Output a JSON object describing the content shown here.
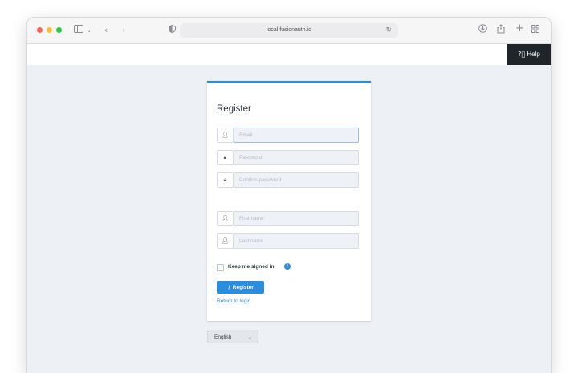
{
  "browser": {
    "url": "local.fusionauth.io",
    "icons": {
      "sidebar": "sidebar-icon",
      "back": "chevron-left-icon",
      "forward": "chevron-right-icon",
      "privacy": "shield-icon",
      "site": "globe-icon",
      "reload": "reload-icon",
      "download": "download-icon",
      "share": "share-icon",
      "new_tab": "plus-icon",
      "tabs_overview": "grid-icon"
    }
  },
  "header": {
    "help_label": "Help"
  },
  "form": {
    "title": "Register",
    "fields": [
      {
        "placeholder": "Email",
        "icon": "user-icon"
      },
      {
        "placeholder": "Password",
        "icon": "lock-icon"
      },
      {
        "placeholder": "Confirm password",
        "icon": "lock-icon"
      },
      {
        "placeholder": "First name",
        "icon": "user-icon"
      },
      {
        "placeholder": "Last name",
        "icon": "user-icon"
      }
    ],
    "keep_signed_in_label": "Keep me signed in",
    "register_label": "Register",
    "return_link": "Return to login"
  },
  "locale": {
    "selected": "English"
  },
  "colors": {
    "accent": "#2c8ddb",
    "help_bg": "#1f2529",
    "page_bg": "#edf1f6"
  }
}
